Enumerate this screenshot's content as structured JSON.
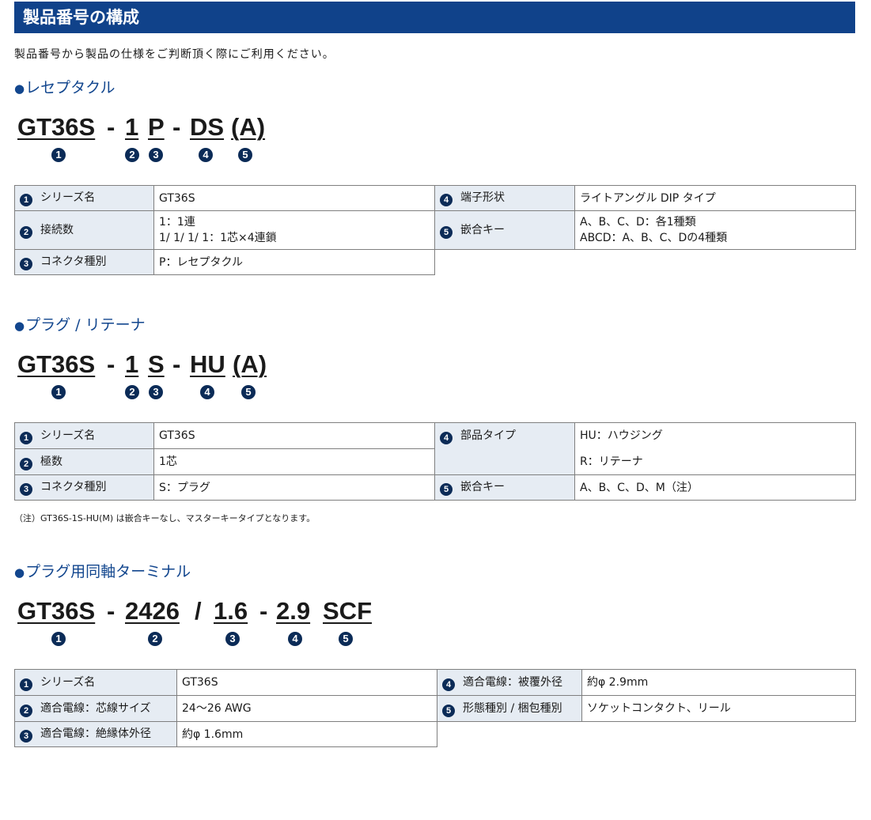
{
  "header": {
    "title": "製品番号の構成"
  },
  "intro": "製品番号から製品の仕様をご判断頂く際にご利用ください。",
  "sections": [
    {
      "heading": "レセプタクル",
      "code": {
        "s1": "GT36S",
        "d1": "-",
        "s2": "1",
        "s3": "P",
        "d2": "-",
        "s4": "DS",
        "s5": "(A)"
      },
      "nums": [
        "1",
        "2",
        "3",
        "4",
        "5"
      ],
      "rows": [
        {
          "num_l": "1",
          "label_l": "シリーズ名",
          "value_l": "GT36S",
          "num_r": "4",
          "label_r": "端子形状",
          "value_r": "ライトアングル DIP タイプ"
        },
        {
          "num_l": "2",
          "label_l": "接続数",
          "value_l": "1：1連",
          "value_l2": "1/ 1/ 1/ 1：1芯×4連鎖",
          "num_r": "5",
          "label_r": "嵌合キー",
          "value_r": "A、B、C、D：各1種類",
          "value_r2": "ABCD：A、B、C、Dの4種類"
        },
        {
          "num_l": "3",
          "label_l": "コネクタ種別",
          "value_l": "P：レセプタクル"
        }
      ]
    },
    {
      "heading": "プラグ / リテーナ",
      "code": {
        "s1": "GT36S",
        "d1": "-",
        "s2": "1",
        "s3": "S",
        "d2": "-",
        "s4": "HU",
        "s5": "(A)"
      },
      "nums": [
        "1",
        "2",
        "3",
        "4",
        "5"
      ],
      "rows": [
        {
          "num_l": "1",
          "label_l": "シリーズ名",
          "value_l": "GT36S",
          "num_r": "4",
          "label_r": "部品タイプ",
          "value_r": "HU：ハウジング"
        },
        {
          "num_l": "2",
          "label_l": "極数",
          "value_l": "1芯",
          "value_r": "R：リテーナ"
        },
        {
          "num_l": "3",
          "label_l": "コネクタ種別",
          "value_l": "S：プラグ",
          "num_r": "5",
          "label_r": "嵌合キー",
          "value_r": "A、B、C、D、M（注）"
        }
      ],
      "note": "（注）GT36S-1S-HU(M) は嵌合キーなし、マスターキータイプとなります。"
    },
    {
      "heading": "プラグ用同軸ターミナル",
      "code": {
        "s1": "GT36S",
        "d1": "-",
        "s2": "2426",
        "d2": "/",
        "s3": "1.6",
        "d3": "-",
        "s4": "2.9",
        "s5": "SCF"
      },
      "nums": [
        "1",
        "2",
        "3",
        "4",
        "5"
      ],
      "rows": [
        {
          "num_l": "1",
          "label_l": "シリーズ名",
          "value_l": "GT36S",
          "num_r": "4",
          "label_r": "適合電線：被覆外径",
          "value_r": "約φ 2.9mm"
        },
        {
          "num_l": "2",
          "label_l": "適合電線：芯線サイズ",
          "value_l": "24～26 AWG",
          "num_r": "5",
          "label_r": "形態種別 / 梱包種別",
          "value_r": "ソケットコンタクト、リール"
        },
        {
          "num_l": "3",
          "label_l": "適合電線：絶縁体外径",
          "value_l": "約φ 1.6mm"
        }
      ]
    }
  ],
  "bullet": "●"
}
